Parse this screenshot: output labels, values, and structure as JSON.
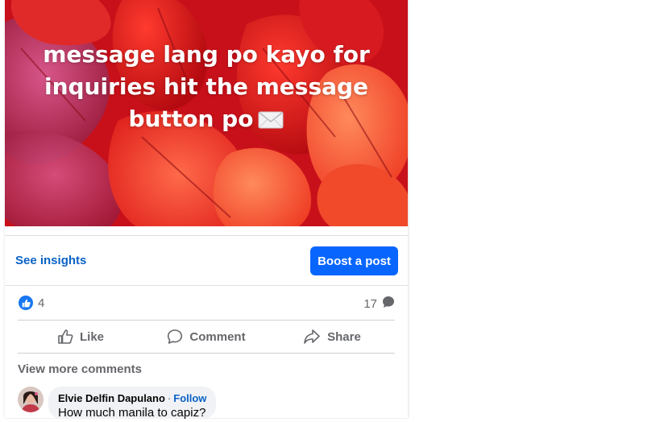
{
  "post": {
    "image_text": "message lang po kayo for inquiries hit the message button po",
    "background_color": "#d81418"
  },
  "insights": {
    "see_insights_label": "See insights",
    "boost_label": "Boost a post",
    "boost_color": "#0866ff"
  },
  "stats": {
    "reaction_count": "4",
    "comment_count": "17"
  },
  "actions": {
    "like_label": "Like",
    "comment_label": "Comment",
    "share_label": "Share"
  },
  "comments": {
    "view_more_label": "View more comments",
    "items": [
      {
        "author": "Elvie Delfin Dapulano",
        "follow_label": "Follow",
        "separator": "·",
        "text": "How much manila to capiz?"
      }
    ]
  }
}
